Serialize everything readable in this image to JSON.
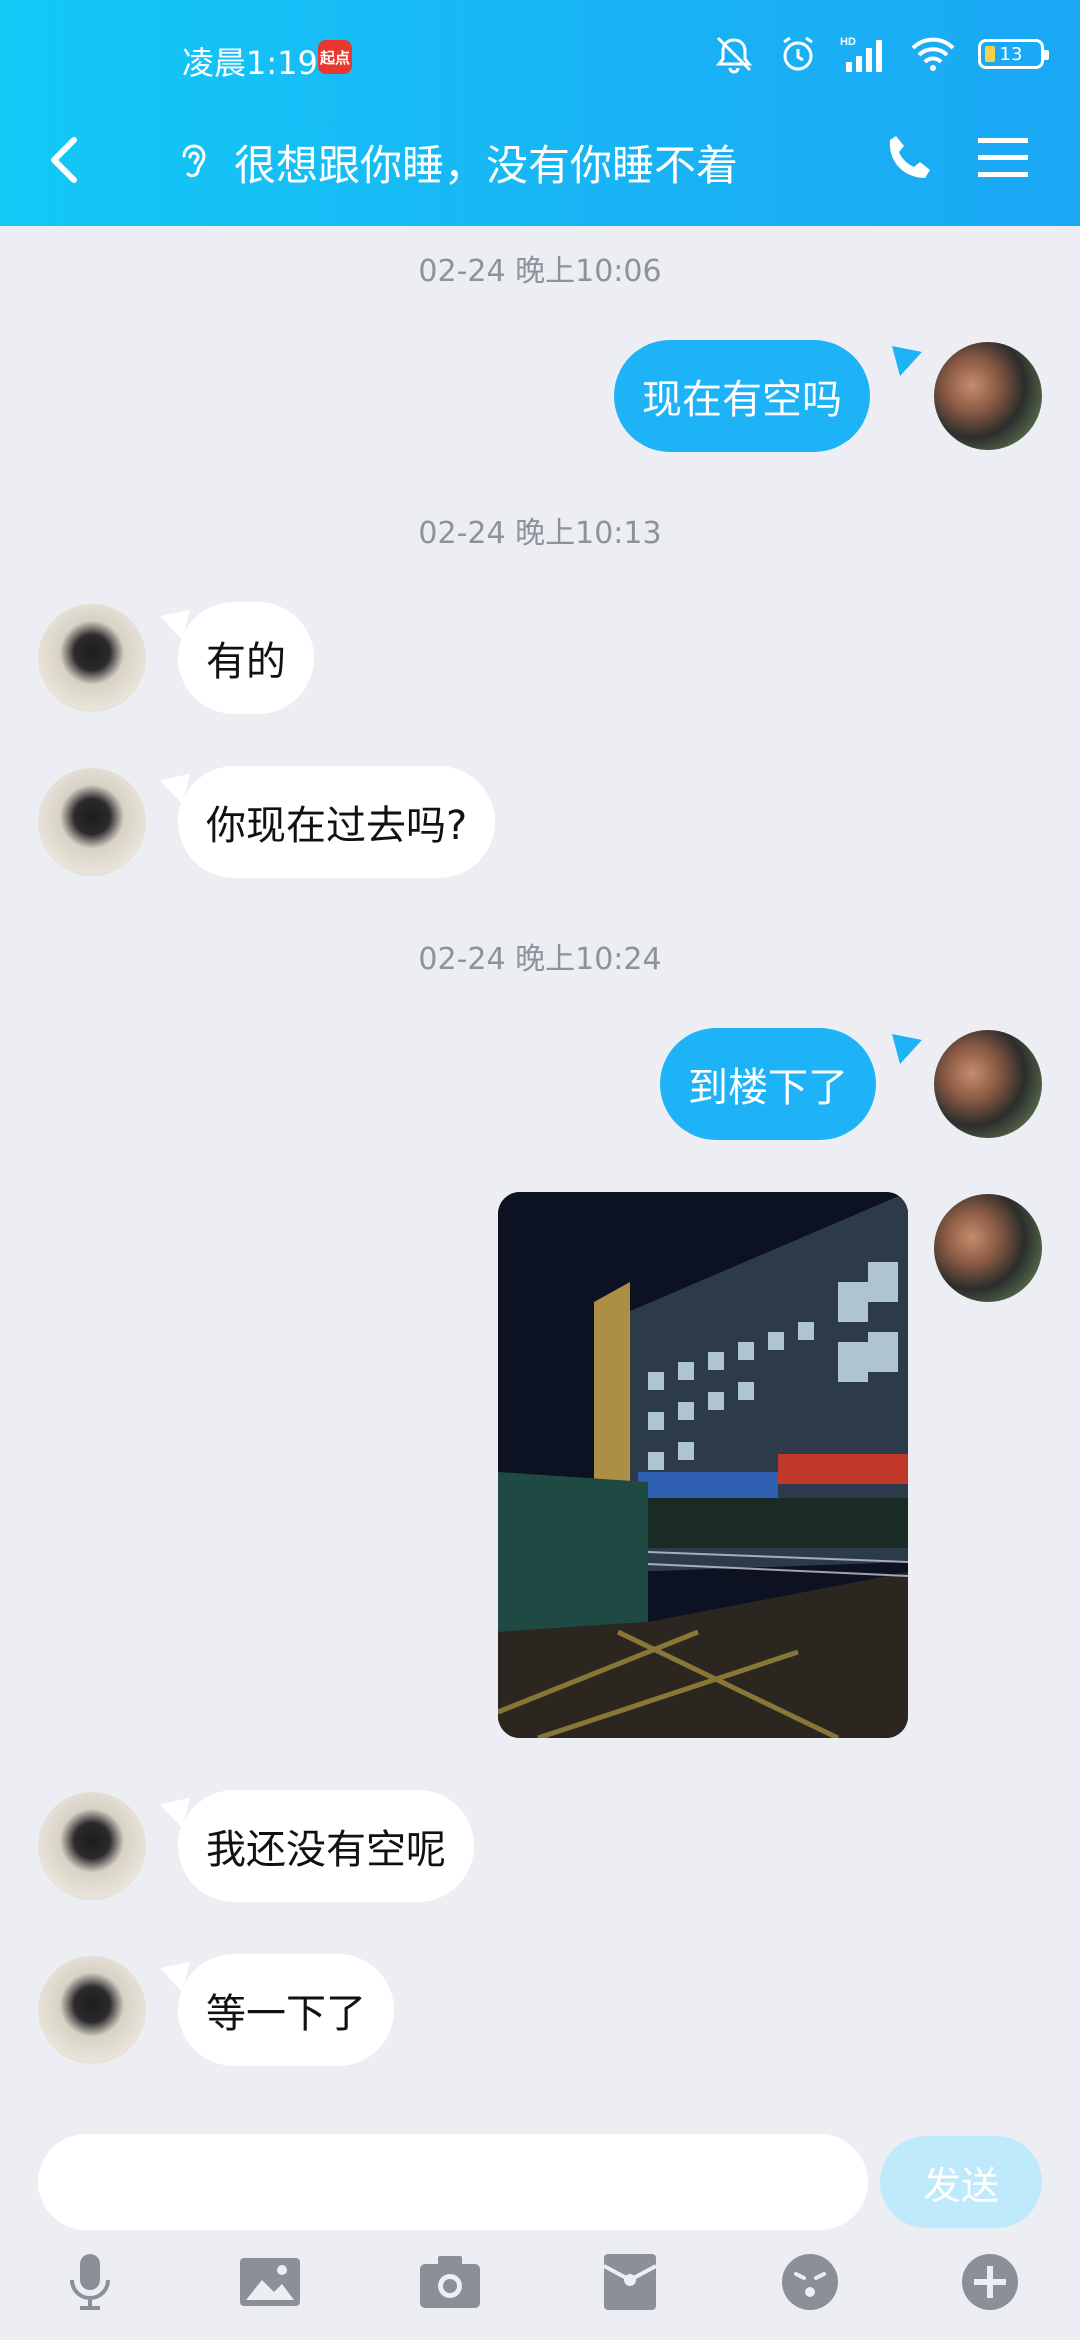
{
  "status_bar": {
    "time": "凌晨1:19",
    "app_badge": "起点",
    "battery": "13"
  },
  "header": {
    "title": "很想跟你睡，没有你睡不着"
  },
  "messages": [
    {
      "type": "timestamp",
      "text": "02-24 晚上10:06"
    },
    {
      "type": "out",
      "text": "现在有空吗"
    },
    {
      "type": "timestamp",
      "text": "02-24 晚上10:13"
    },
    {
      "type": "in",
      "text": "有的"
    },
    {
      "type": "in",
      "text": "你现在过去吗?"
    },
    {
      "type": "timestamp",
      "text": "02-24 晚上10:24"
    },
    {
      "type": "out",
      "text": "到楼下了"
    },
    {
      "type": "out_image",
      "text": ""
    },
    {
      "type": "in",
      "text": "我还没有空呢"
    },
    {
      "type": "in",
      "text": "等一下了"
    }
  ],
  "composer": {
    "input_value": "",
    "send_label": "发送"
  },
  "toolbar": {
    "icons": [
      "microphone-icon",
      "image-icon",
      "camera-icon",
      "red-packet-icon",
      "emoji-icon",
      "plus-icon"
    ]
  },
  "colors": {
    "header_start": "#12c9f6",
    "header_end": "#1aa8f5",
    "outgoing_bubble": "#1eb3f7",
    "incoming_bubble": "#ffffff",
    "background": "#eceef3",
    "send_disabled": "#bfeafb"
  }
}
